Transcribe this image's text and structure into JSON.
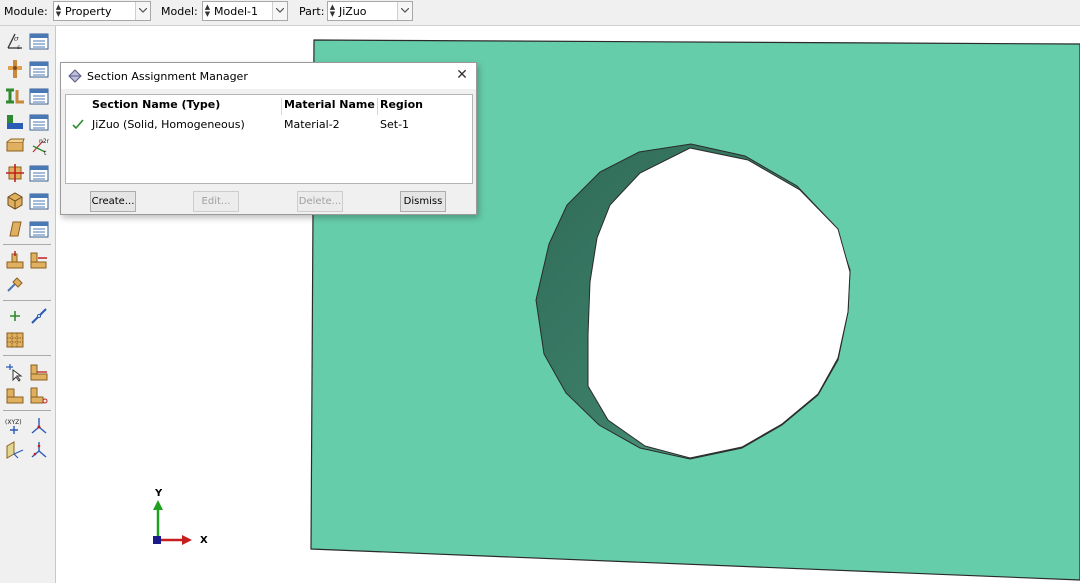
{
  "topbar": {
    "module_label": "Module:",
    "module_value": "Property",
    "model_label": "Model:",
    "model_value": "Model-1",
    "part_label": "Part:",
    "part_value": "JiZuo"
  },
  "dialog": {
    "title": "Section Assignment Manager",
    "columns": [
      "Section Name (Type)",
      "Material Name",
      "Region"
    ],
    "rows": [
      {
        "section": "JiZuo (Solid, Homogeneous)",
        "material": "Material-2",
        "region": "Set-1",
        "status_icon": "checkmark-icon"
      }
    ],
    "buttons": {
      "create": "Create...",
      "edit": "Edit...",
      "delete": "Delete...",
      "dismiss": "Dismiss"
    }
  },
  "triad": {
    "y_label": "Y",
    "x_label": "X"
  },
  "colors": {
    "part_face": "#66cdaa",
    "hole_inner_dark": "#2f6b58",
    "hole_inner_light": "#5fb596",
    "check": "#2e8b2e"
  },
  "toolbox_icons": [
    "create-material-icon",
    "material-manager-icon",
    "create-section-icon",
    "section-manager-icon",
    "create-profile-icon",
    "profile-manager-icon",
    "assign-section-icon",
    "assign-section-manager-icon",
    "assign-beam-orientation-icon",
    "assign-normal-icon",
    "assign-material-orientation-icon",
    "orientation-manager-icon",
    "create-composite-layup-icon",
    "layup-manager-icon",
    "skin-icon",
    "skin-manager-icon",
    "special-inertia-icon",
    "springs-dashpots-icon",
    "datum-csys-icon",
    "datum-point-icon",
    "datum-axis-icon",
    "partition-icon",
    "query-icon",
    "assign-section-2-icon",
    "engineering-feature-icon",
    "engineering-feature-2-icon",
    "coordinate-icon",
    "triad-icon",
    "plane-icon",
    "axis-system-icon"
  ]
}
